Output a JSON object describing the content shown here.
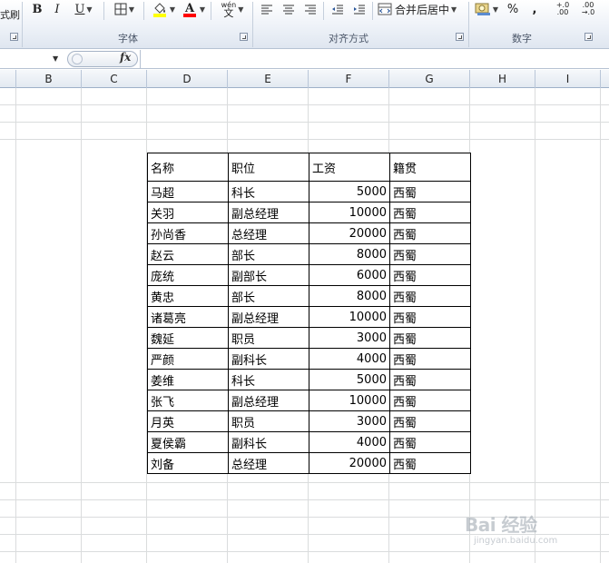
{
  "ribbon": {
    "clip_label": "式刷",
    "bold": "B",
    "italic": "I",
    "underline": "U",
    "wen_label": "wén",
    "wen_char": "文",
    "merge_center": "合并后居中",
    "percent": "%",
    "comma": ",",
    "inc_decimal": "+.0\n.00",
    "dec_decimal": ".00\n→.0",
    "groups": {
      "font": "字体",
      "alignment": "对齐方式",
      "number": "数字"
    },
    "colors": {
      "fill": "#ffff00",
      "font": "#ff0000",
      "accent": "#2b579a"
    }
  },
  "formula_bar": {
    "name_box": "",
    "fx": "fx",
    "formula": ""
  },
  "columns": [
    "B",
    "C",
    "D",
    "E",
    "F",
    "G",
    "H",
    "I"
  ],
  "table": {
    "headers": [
      "名称",
      "职位",
      "工资",
      "籍贯"
    ],
    "rows": [
      [
        "马超",
        "科长",
        "5000",
        "西蜀"
      ],
      [
        "关羽",
        "副总经理",
        "10000",
        "西蜀"
      ],
      [
        "孙尚香",
        "总经理",
        "20000",
        "西蜀"
      ],
      [
        "赵云",
        "部长",
        "8000",
        "西蜀"
      ],
      [
        "庞统",
        "副部长",
        "6000",
        "西蜀"
      ],
      [
        "黄忠",
        "部长",
        "8000",
        "西蜀"
      ],
      [
        "诸葛亮",
        "副总经理",
        "10000",
        "西蜀"
      ],
      [
        "魏延",
        "职员",
        "3000",
        "西蜀"
      ],
      [
        "严颜",
        "副科长",
        "4000",
        "西蜀"
      ],
      [
        "姜维",
        "科长",
        "5000",
        "西蜀"
      ],
      [
        "张飞",
        "副总经理",
        "10000",
        "西蜀"
      ],
      [
        "月英",
        "职员",
        "3000",
        "西蜀"
      ],
      [
        "夏侯霸",
        "副科长",
        "4000",
        "西蜀"
      ],
      [
        "刘备",
        "总经理",
        "20000",
        "西蜀"
      ]
    ]
  },
  "watermark": {
    "text": "Bai 经验",
    "sub": "jingyan.baidu.com"
  }
}
